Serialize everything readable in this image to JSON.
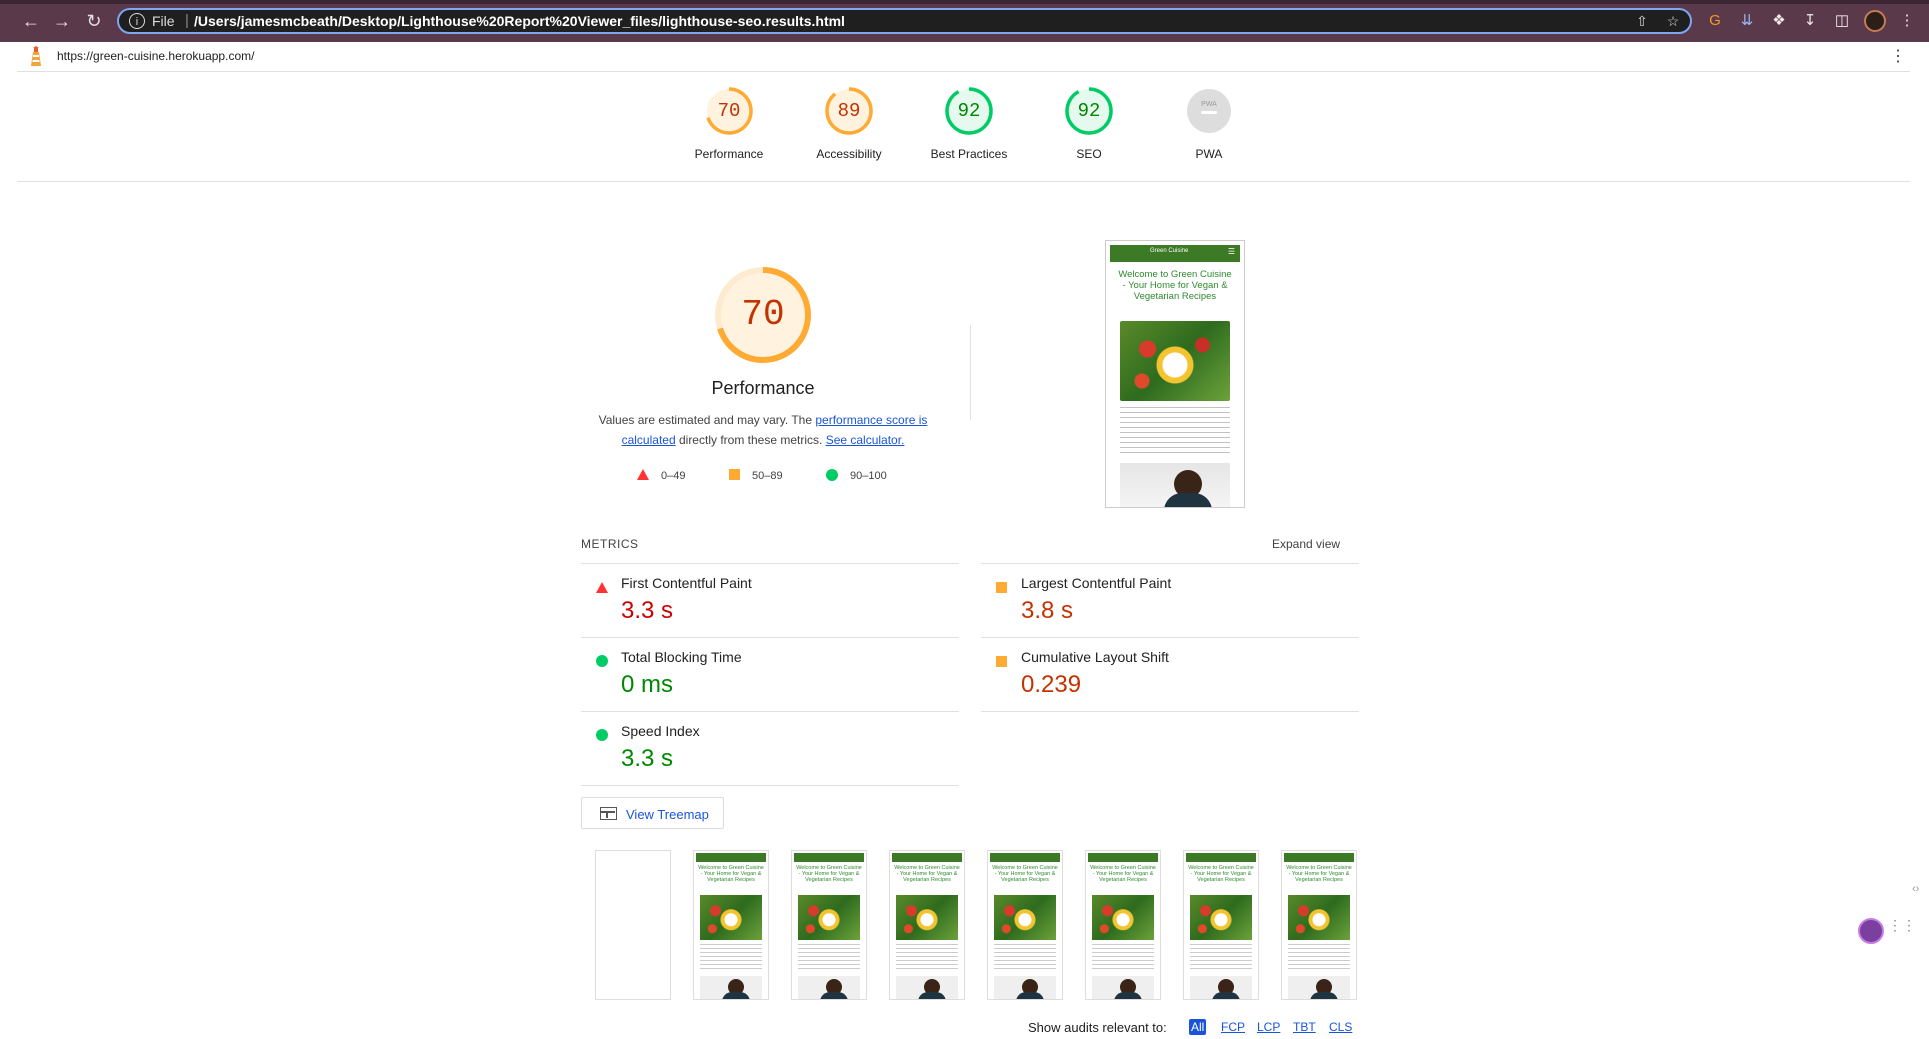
{
  "browser": {
    "scheme_label": "File",
    "address": "/Users/jamesmcbeath/Desktop/Lighthouse%20Report%20Viewer_files/lighthouse-seo.results.html"
  },
  "lighthouse": {
    "url": "https://green-cuisine.herokuapp.com/",
    "gauges": [
      {
        "label": "Performance",
        "score": "70",
        "color": "#fa3"
      },
      {
        "label": "Accessibility",
        "score": "89",
        "color": "#fa3"
      },
      {
        "label": "Best Practices",
        "score": "92",
        "color": "#0c6"
      },
      {
        "label": "SEO",
        "score": "92",
        "color": "#0c6"
      },
      {
        "label": "PWA",
        "score": "PWA",
        "color": "#cccccc"
      }
    ],
    "performance": {
      "score": "70",
      "title": "Performance",
      "desc_before": "Values are estimated and may vary. The ",
      "desc_link1": "performance score is calculated",
      "desc_middle": " directly from these metrics. ",
      "desc_link2": "See calculator.",
      "legend": [
        "0–49",
        "50–89",
        "90–100"
      ]
    },
    "screenshot": {
      "site_name": "Green Cuisine",
      "heading": "Welcome to Green Cuisine - Your Home for Vegan & Vegetarian Recipes"
    },
    "metrics": {
      "label": "METRICS",
      "expand": "Expand view",
      "items": [
        {
          "name": "First Contentful Paint",
          "value": "3.3 s",
          "rating": "fail"
        },
        {
          "name": "Largest Contentful Paint",
          "value": "3.8 s",
          "rating": "average"
        },
        {
          "name": "Total Blocking Time",
          "value": "0 ms",
          "rating": "pass"
        },
        {
          "name": "Cumulative Layout Shift",
          "value": "0.239",
          "rating": "average"
        },
        {
          "name": "Speed Index",
          "value": "3.3 s",
          "rating": "pass"
        }
      ]
    },
    "treemap_label": "View Treemap",
    "filter": {
      "label": "Show audits relevant to:",
      "options": [
        "All",
        "FCP",
        "LCP",
        "TBT",
        "CLS"
      ]
    },
    "colors": {
      "fail": "#ff3333",
      "average": "#ffaa33",
      "pass": "#00cc66"
    }
  }
}
